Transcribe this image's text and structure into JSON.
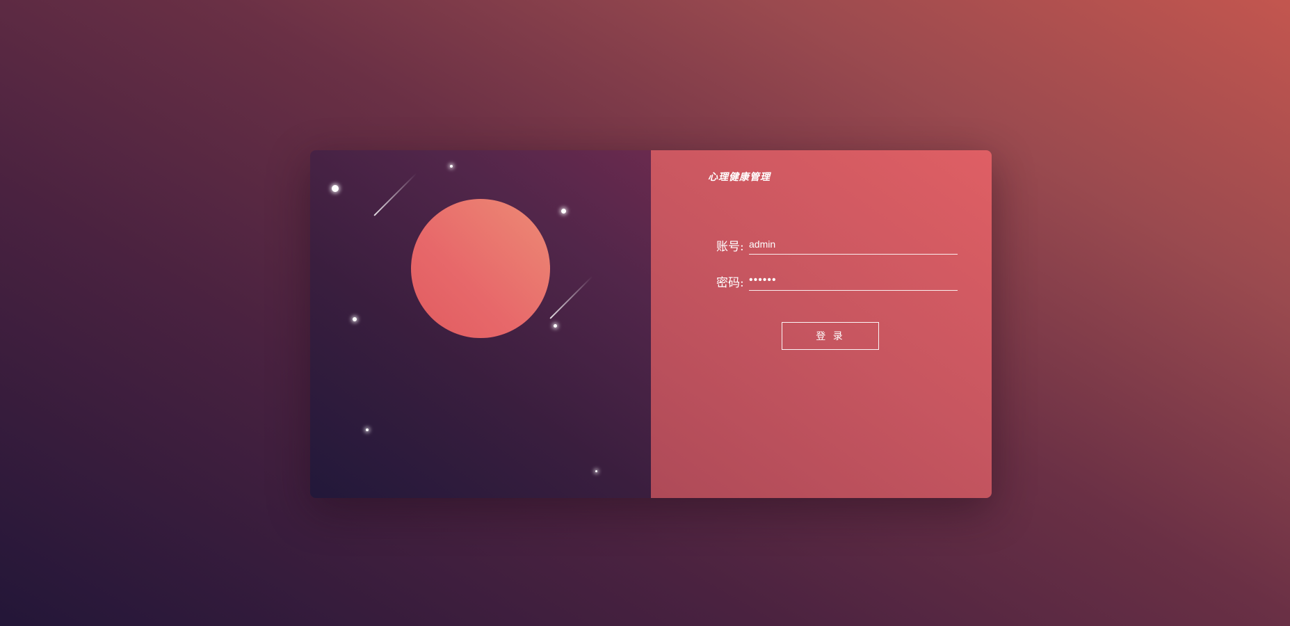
{
  "app": {
    "title": "心理健康管理"
  },
  "login_form": {
    "account_label": "账号:",
    "account_value": "admin",
    "password_label": "密码:",
    "password_value": "123456",
    "login_button_label": "登 录"
  },
  "theme": {
    "background_start": "#231638",
    "background_end": "#c3564f",
    "left_panel": "#3a1e3e",
    "right_panel": "#c75660",
    "planet": "#e7686a",
    "text": "#ffffff"
  },
  "decorations": {
    "planet_icon": "planet-icon",
    "star_icon": "star-icon",
    "meteor_icon": "meteor-icon"
  }
}
